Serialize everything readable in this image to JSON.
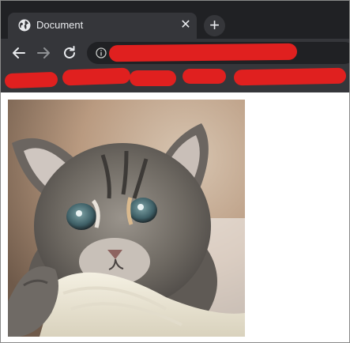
{
  "window": {
    "tab": {
      "title": "Document",
      "favicon": "globe-icon",
      "close_icon": "close-icon"
    },
    "new_tab_icon": "plus-icon"
  },
  "toolbar": {
    "back_icon": "back-arrow-icon",
    "forward_icon": "forward-arrow-icon",
    "reload_icon": "reload-icon",
    "site_info_icon": "info-icon",
    "address_text": ""
  },
  "bookmarks_bar": {
    "items": [
      "",
      "",
      "",
      "",
      ""
    ]
  },
  "content": {
    "image_subject": "kitten-photo"
  },
  "colors": {
    "chrome_dark": "#202124",
    "toolbar": "#35363a",
    "text": "#e8eaed",
    "redaction": "#e0201f"
  }
}
